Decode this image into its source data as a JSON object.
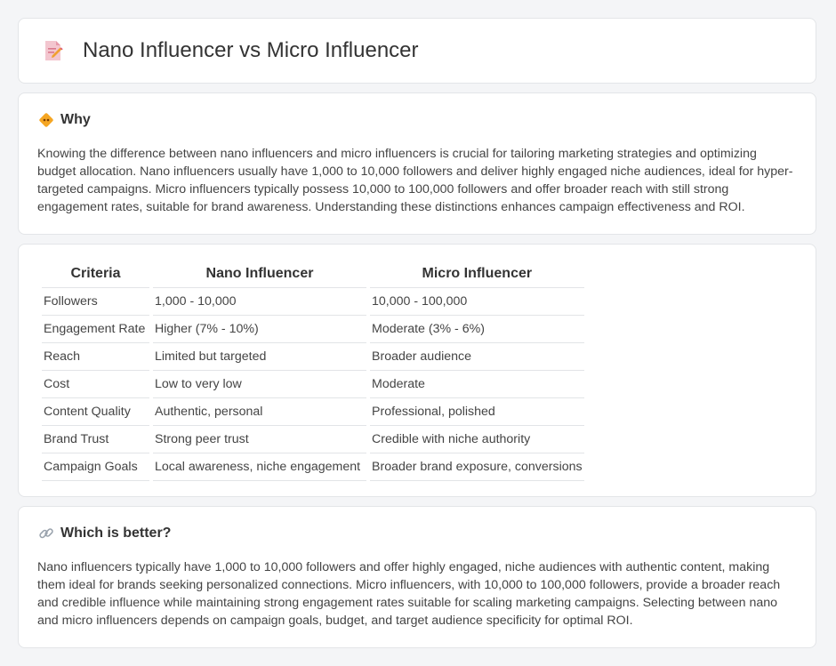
{
  "header": {
    "title": "Nano Influencer vs Micro Influencer",
    "icon": "document-pencil-icon"
  },
  "why": {
    "heading": "Why",
    "icon": "diamond-warning-icon",
    "text": "Knowing the difference between nano influencers and micro influencers is crucial for tailoring marketing strategies and optimizing budget allocation. Nano influencers usually have 1,000 to 10,000 followers and deliver highly engaged niche audiences, ideal for hyper-targeted campaigns. Micro influencers typically possess 10,000 to 100,000 followers and offer broader reach with still strong engagement rates, suitable for brand awareness. Understanding these distinctions enhances campaign effectiveness and ROI."
  },
  "table": {
    "headers": [
      "Criteria",
      "Nano Influencer",
      "Micro Influencer"
    ],
    "rows": [
      [
        "Followers",
        "1,000 - 10,000",
        "10,000 - 100,000"
      ],
      [
        "Engagement Rate",
        "Higher (7% - 10%)",
        "Moderate (3% - 6%)"
      ],
      [
        "Reach",
        "Limited but targeted",
        "Broader audience"
      ],
      [
        "Cost",
        "Low to very low",
        "Moderate"
      ],
      [
        "Content Quality",
        "Authentic, personal",
        "Professional, polished"
      ],
      [
        "Brand Trust",
        "Strong peer trust",
        "Credible with niche authority"
      ],
      [
        "Campaign Goals",
        "Local awareness, niche engagement",
        "Broader brand exposure, conversions"
      ]
    ]
  },
  "better": {
    "heading": "Which is better?",
    "icon": "link-icon",
    "text": "Nano influencers typically have 1,000 to 10,000 followers and offer highly engaged, niche audiences with authentic content, making them ideal for brands seeking personalized connections. Micro influencers, with 10,000 to 100,000 followers, provide a broader reach and credible influence while maintaining strong engagement rates suitable for scaling marketing campaigns. Selecting between nano and micro influencers depends on campaign goals, budget, and target audience specificity for optimal ROI."
  },
  "colors": {
    "background": "#f4f5f7",
    "card": "#ffffff",
    "accent_orange": "#f5a623",
    "icon_pink": "#f08aa0"
  }
}
